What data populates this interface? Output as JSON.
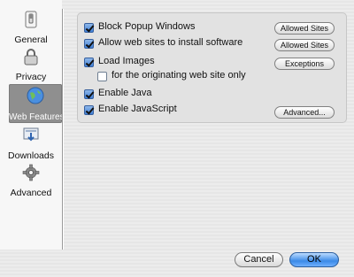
{
  "sidebar": {
    "items": [
      {
        "label": "General",
        "icon": "general-switch-icon"
      },
      {
        "label": "Privacy",
        "icon": "lock-icon"
      },
      {
        "label": "Web Features",
        "icon": "globe-icon"
      },
      {
        "label": "Downloads",
        "icon": "download-icon"
      },
      {
        "label": "Advanced",
        "icon": "gear-icon"
      }
    ],
    "selected": "Web Features"
  },
  "web_features": {
    "block_popups": {
      "label": "Block Popup Windows",
      "checked": true,
      "button": "Allowed Sites"
    },
    "allow_install": {
      "label": "Allow web sites to install software",
      "checked": true,
      "button": "Allowed Sites"
    },
    "load_images": {
      "label": "Load Images",
      "checked": true,
      "button": "Exceptions"
    },
    "originating_only": {
      "label": "for the originating web site only",
      "checked": false
    },
    "enable_java": {
      "label": "Enable Java",
      "checked": true
    },
    "enable_javascript": {
      "label": "Enable JavaScript",
      "checked": true,
      "button": "Advanced..."
    }
  },
  "buttons": {
    "cancel": "Cancel",
    "ok": "OK"
  },
  "colors": {
    "accent": "#3b8ae7",
    "selected_nav": "#8f8f8f"
  }
}
